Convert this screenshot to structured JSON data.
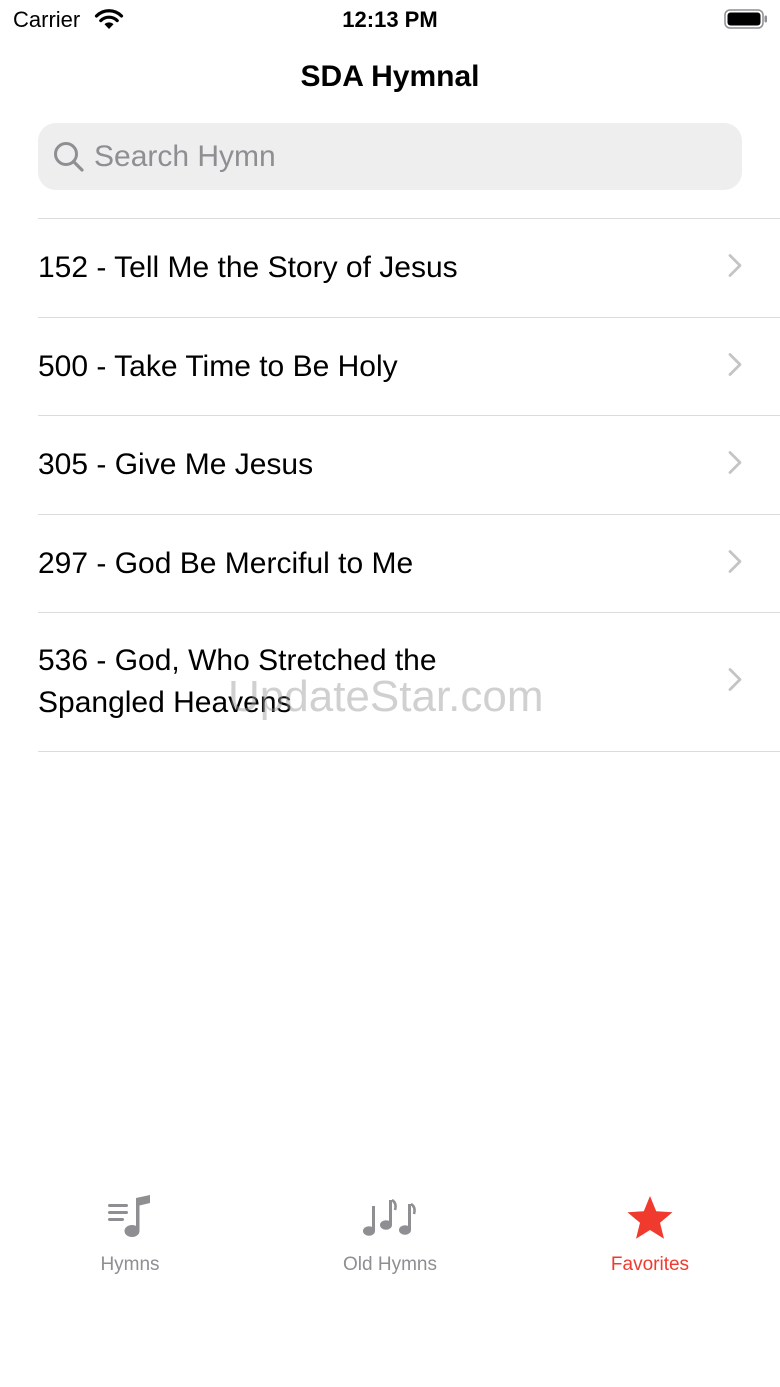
{
  "status_bar": {
    "carrier": "Carrier",
    "time": "12:13 PM"
  },
  "header": {
    "title": "SDA Hymnal"
  },
  "search": {
    "placeholder": "Search Hymn",
    "value": ""
  },
  "hymns": [
    {
      "label": "152 - Tell Me the Story of Jesus"
    },
    {
      "label": "500 - Take Time to Be Holy"
    },
    {
      "label": "305 - Give Me Jesus"
    },
    {
      "label": "297 - God Be Merciful to Me"
    },
    {
      "label": "536 - God, Who Stretched the Spangled Heavens"
    }
  ],
  "tabs": [
    {
      "label": "Hymns",
      "icon": "music-list-icon",
      "active": false
    },
    {
      "label": "Old Hymns",
      "icon": "music-notes-icon",
      "active": false
    },
    {
      "label": "Favorites",
      "icon": "star-icon",
      "active": true
    }
  ],
  "watermark": "UpdateStar.com",
  "colors": {
    "accent": "#f03a2e",
    "inactive": "#8e8e93",
    "search_bg": "#eeeeef",
    "separator": "#dcdcdf"
  }
}
